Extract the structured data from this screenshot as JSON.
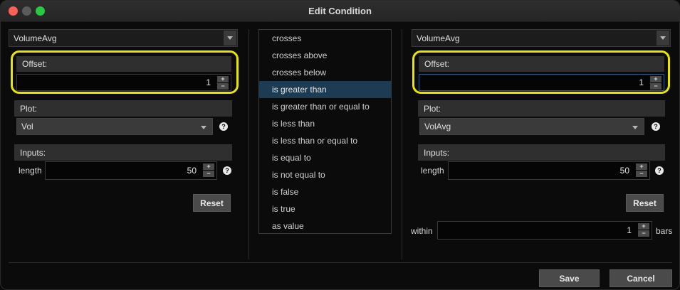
{
  "window": {
    "title": "Edit Condition"
  },
  "left": {
    "study": "VolumeAvg",
    "offset_label": "Offset:",
    "offset_value": "1",
    "plot_label": "Plot:",
    "plot_value": "Vol",
    "inputs_label": "Inputs:",
    "length_label": "length",
    "length_value": "50",
    "reset_label": "Reset"
  },
  "conditions": {
    "items": [
      "crosses",
      "crosses above",
      "crosses below",
      "is greater than",
      "is greater than or equal to",
      "is less than",
      "is less than or equal to",
      "is equal to",
      "is not equal to",
      "is false",
      "is true",
      "as value"
    ],
    "selected": "is greater than"
  },
  "right": {
    "study": "VolumeAvg",
    "offset_label": "Offset:",
    "offset_value": "1",
    "plot_label": "Plot:",
    "plot_value": "VolAvg",
    "inputs_label": "Inputs:",
    "length_label": "length",
    "length_value": "50",
    "reset_label": "Reset",
    "within_label": "within",
    "within_value": "1",
    "bars_label": "bars"
  },
  "footer": {
    "save_label": "Save",
    "cancel_label": "Cancel"
  },
  "icons": {
    "plus": "+",
    "minus": "−",
    "help": "?"
  },
  "colors": {
    "highlight": "#e8e600",
    "selected_row": "#1d3b52"
  }
}
